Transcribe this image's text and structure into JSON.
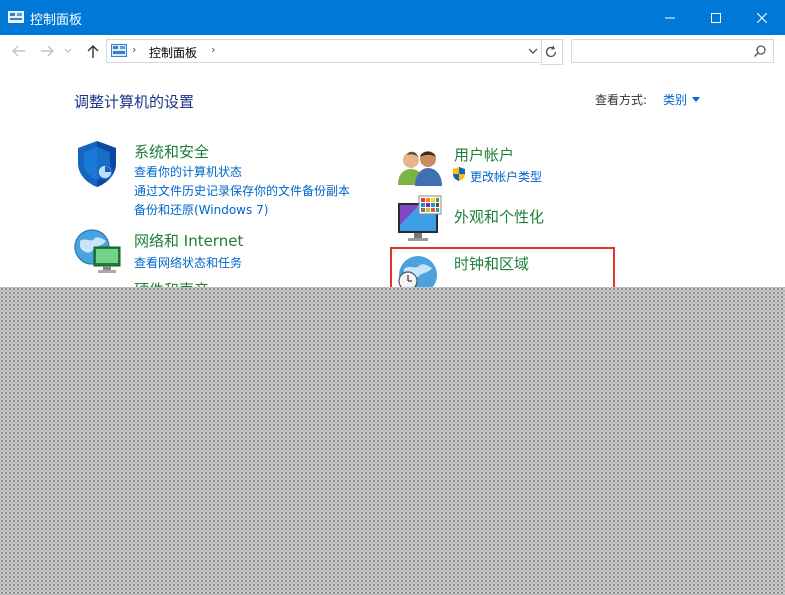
{
  "window": {
    "title": "控制面板"
  },
  "address_bar": {
    "path": "控制面板",
    "separator": "›"
  },
  "search": {
    "placeholder": ""
  },
  "main": {
    "heading": "调整计算机的设置",
    "view_by_label": "查看方式:",
    "view_by_value": "类别"
  },
  "categories": {
    "security": {
      "title": "系统和安全",
      "links": [
        "查看你的计算机状态",
        "通过文件历史记录保存你的文件备份副本",
        "备份和还原(Windows 7)"
      ]
    },
    "network": {
      "title": "网络和 Internet",
      "links": [
        "查看网络状态和任务"
      ]
    },
    "hardware": {
      "title": "硬件和声音"
    },
    "user_accounts": {
      "title": "用户帐户",
      "links": [
        "更改帐户类型"
      ]
    },
    "appearance": {
      "title": "外观和个性化"
    },
    "clock_region": {
      "title": "时钟和区域"
    }
  },
  "colors": {
    "titlebar": "#0078d7",
    "heading": "#1e3287",
    "category_title": "#1e7e34",
    "link": "#0066cc",
    "highlight_border": "#e0342c"
  },
  "icons": [
    "control-panel-icon",
    "minimize-icon",
    "maximize-icon",
    "close-icon",
    "back-arrow-icon",
    "forward-arrow-icon",
    "recent-dropdown-icon",
    "up-arrow-icon",
    "address-dropdown-icon",
    "refresh-icon",
    "search-icon",
    "shield-icon",
    "network-globe-icon",
    "users-icon",
    "uac-shield-icon",
    "monitor-palette-icon",
    "clock-globe-icon"
  ]
}
